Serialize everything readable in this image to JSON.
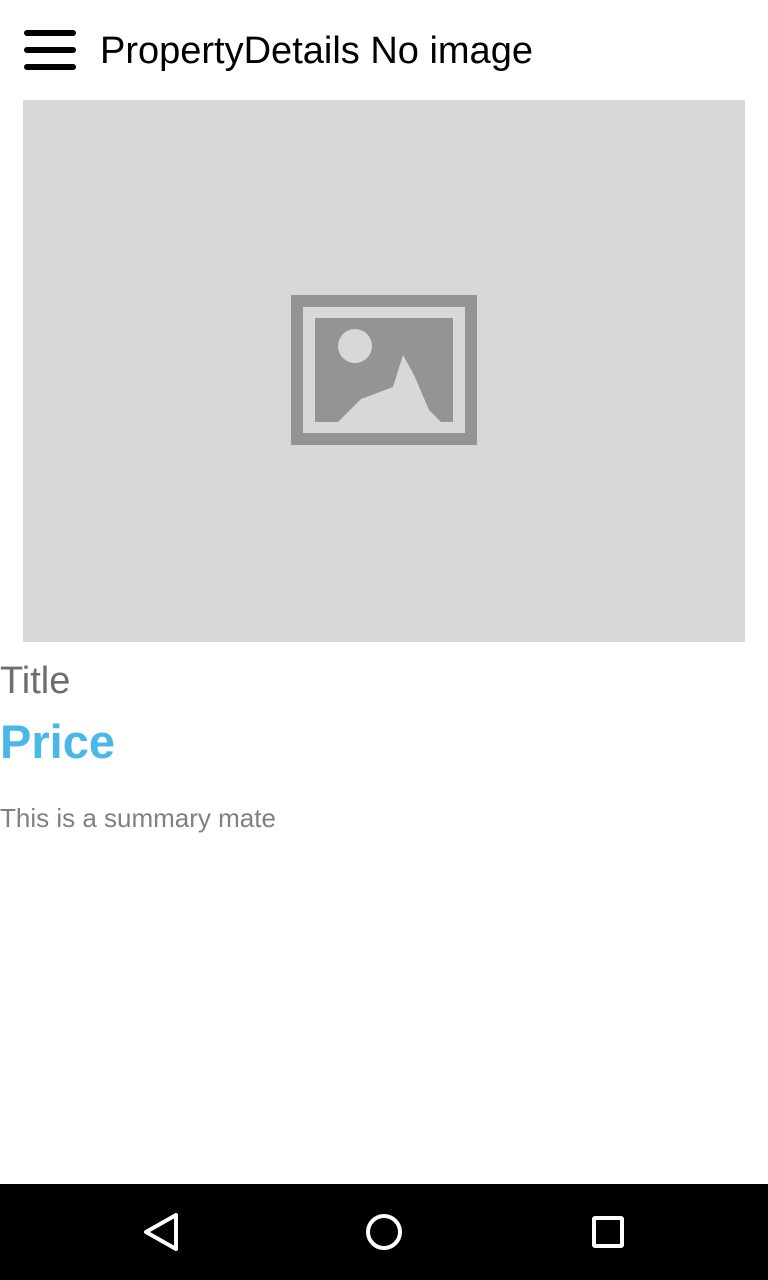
{
  "app_bar": {
    "menu_icon": "hamburger-menu-icon",
    "title": "PropertyDetails No image"
  },
  "property": {
    "image_icon": "image-placeholder-icon",
    "title": "Title",
    "price": "Price",
    "summary": "This is a summary mate"
  },
  "nav_bar": {
    "back_icon": "back-triangle-icon",
    "home_icon": "home-circle-icon",
    "recents_icon": "recents-square-icon"
  },
  "colors": {
    "price": "#4ab8e6",
    "placeholder_bg": "#d8d8d8",
    "placeholder_icon": "#949494"
  }
}
